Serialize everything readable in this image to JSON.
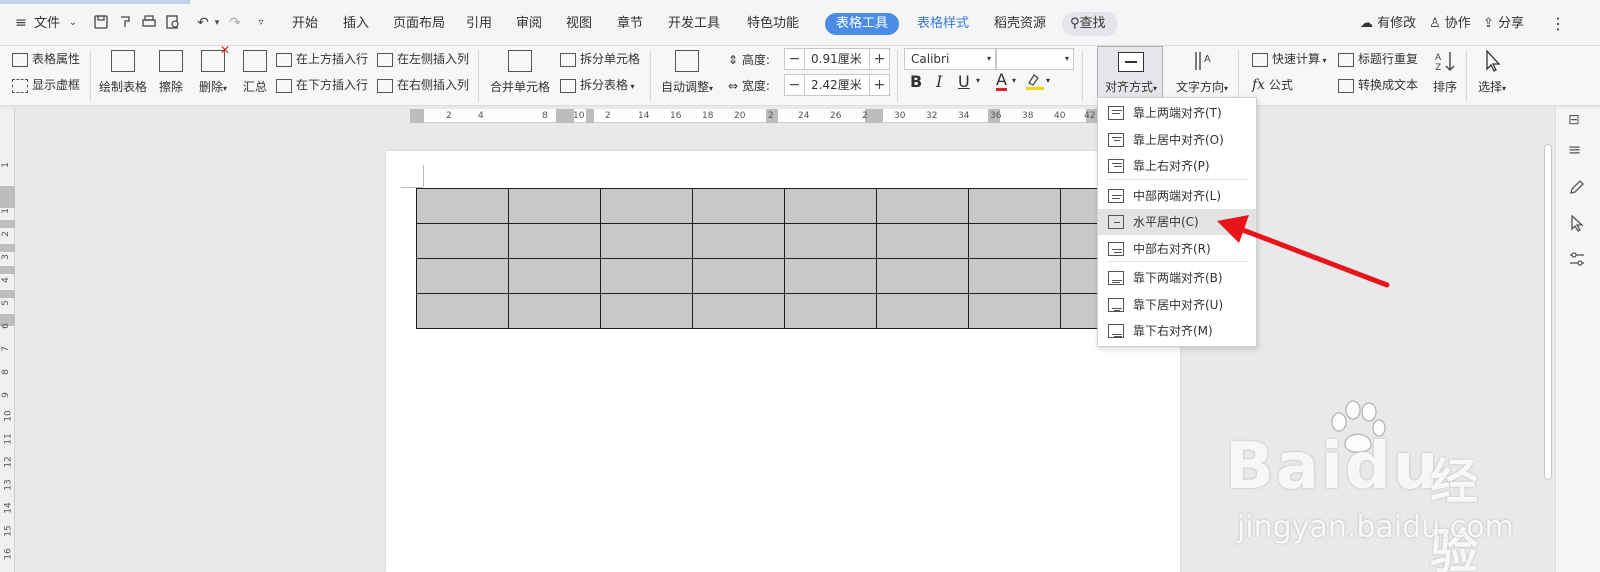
{
  "menubar": {
    "file_label": "文件",
    "tabs": [
      "开始",
      "插入",
      "页面布局",
      "引用",
      "审阅",
      "视图",
      "章节",
      "开发工具",
      "特色功能"
    ],
    "active_tab": "表格工具",
    "table_style_tab": "表格样式",
    "resource_tab": "稻壳资源",
    "search_label": "查找",
    "modified_label": "有修改",
    "collab_label": "协作",
    "share_label": "分享"
  },
  "ribbon": {
    "table_props": "表格属性",
    "show_gridlines": "显示虚框",
    "draw_table": "绘制表格",
    "erase": "擦除",
    "delete": "删除",
    "summary": "汇总",
    "insert_row_above": "在上方插入行",
    "insert_row_below": "在下方插入行",
    "insert_col_left": "在左侧插入列",
    "insert_col_right": "在右侧插入列",
    "merge_cells": "合并单元格",
    "split_cells": "拆分单元格",
    "split_table": "拆分表格",
    "auto_fit": "自动调整",
    "height_label": "高度:",
    "height_value": "0.91厘米",
    "width_label": "宽度:",
    "width_value": "2.42厘米",
    "font_name": "Calibri",
    "bold": "B",
    "italic": "I",
    "underline": "U",
    "font_color": "A",
    "align_label": "对齐方式",
    "text_direction": "文字方向",
    "quick_calc": "快速计算",
    "formula": "公式",
    "repeat_header": "标题行重复",
    "convert_to_text": "转换成文本",
    "sort": "排序",
    "select": "选择"
  },
  "ruler": {
    "h_ticks": [
      "2",
      "4",
      "8",
      "10",
      "2",
      "14",
      "16",
      "18",
      "20",
      "2",
      "24",
      "26",
      "2",
      "30",
      "32",
      "34",
      "36",
      "38",
      "40",
      "42"
    ],
    "v_ticks": [
      "1",
      "1",
      "2",
      "3",
      "4",
      "5",
      "6",
      "7",
      "8",
      "9",
      "10",
      "11",
      "12",
      "13",
      "14",
      "15",
      "16"
    ]
  },
  "table": {
    "rows": 4,
    "cols": 8
  },
  "dropdown": {
    "items": [
      "靠上两端对齐(T)",
      "靠上居中对齐(O)",
      "靠上右对齐(P)",
      "中部两端对齐(L)",
      "水平居中(C)",
      "中部右对齐(R)",
      "靠下两端对齐(B)",
      "靠下居中对齐(U)",
      "靠下右对齐(M)"
    ],
    "hovered_index": 4
  },
  "colors": {
    "accent": "#4a8ce6",
    "arrow": "#e8141b",
    "table_fill": "#c8c8c8",
    "highlight_yellow": "#f5d20a",
    "font_red": "#e02020"
  },
  "watermark": {
    "brand": "Bai",
    "du": "du",
    "cn": "经验",
    "url": "jingyan.baidu.com"
  }
}
